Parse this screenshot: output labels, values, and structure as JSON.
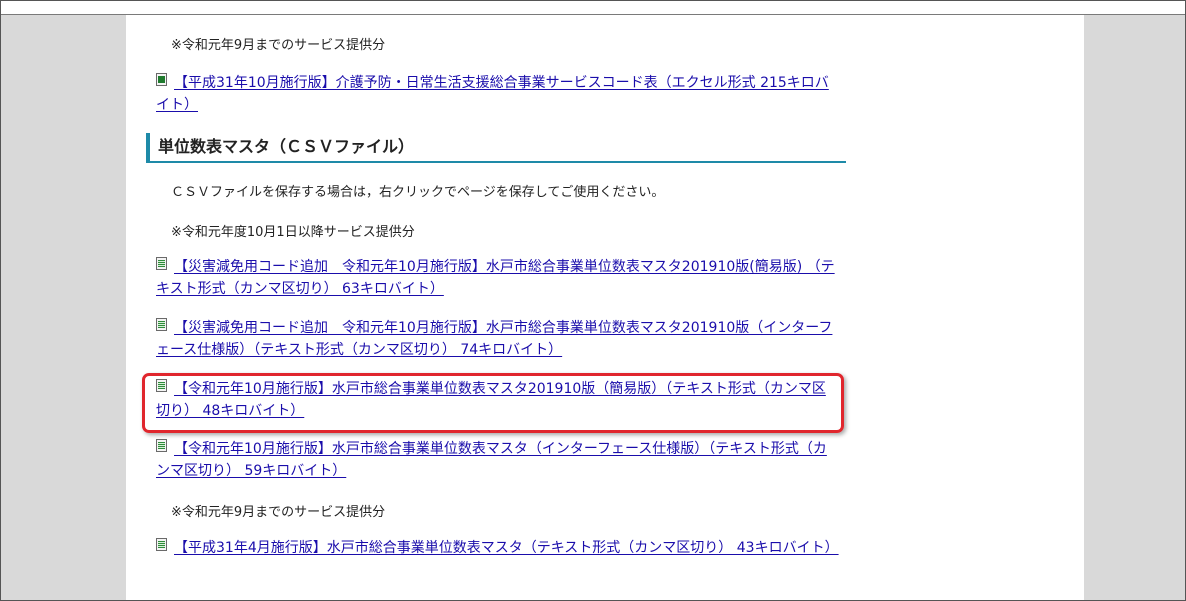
{
  "notes": {
    "top_note": "※令和元年9月までのサービス提供分",
    "csv_instruction": "ＣＳＶファイルを保存する場合は，右クリックでページを保存してご使用ください。",
    "from_oct_note": "※令和元年度10月1日以降サービス提供分",
    "until_sep_note": "※令和元年9月までのサービス提供分"
  },
  "links": {
    "excel_h31_oct": "【平成31年10月施行版】介護予防・日常生活支援総合事業サービスコード表（エクセル形式 215キロバイト）",
    "disaster_simple": "【災害減免用コード追加　令和元年10月施行版】水戸市総合事業単位数表マスタ201910版(簡易版) （テキスト形式（カンマ区切り） 63キロバイト）",
    "disaster_interface": "【災害減免用コード追加　令和元年10月施行版】水戸市総合事業単位数表マスタ201910版（インターフェース仕様版）（テキスト形式（カンマ区切り） 74キロバイト）",
    "r1_oct_simple": "【令和元年10月施行版】水戸市総合事業単位数表マスタ201910版（簡易版）（テキスト形式（カンマ区切り） 48キロバイト）",
    "r1_oct_interface": "【令和元年10月施行版】水戸市総合事業単位数表マスタ（インターフェース仕様版）（テキスト形式（カンマ区切り） 59キロバイト）",
    "h31_apr": "【平成31年4月施行版】水戸市総合事業単位数表マスタ（テキスト形式（カンマ区切り） 43キロバイト）"
  },
  "section": {
    "heading": "単位数表マスタ（ＣＳＶファイル）"
  },
  "icons": {
    "excel": "excel-file-icon",
    "text": "text-file-icon"
  },
  "colors": {
    "link": "#1a0dab",
    "section_accent": "#1e8aa8",
    "highlight": "#e0262d",
    "side_background": "#d9d9d9"
  }
}
